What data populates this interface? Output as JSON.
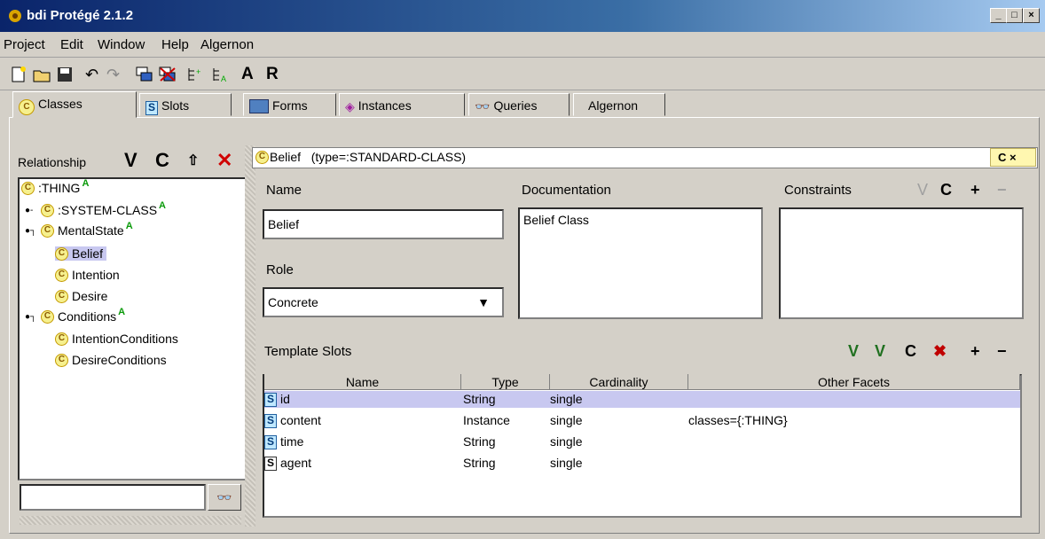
{
  "window": {
    "title": "bdi  Protégé 2.1.2"
  },
  "menu": [
    "Project",
    "Edit",
    "Window",
    "Help",
    "Algernon"
  ],
  "toolbar": {
    "a_label": "A",
    "r_label": "R"
  },
  "tabs": [
    {
      "label": "Classes"
    },
    {
      "label": "Slots"
    },
    {
      "label": "Forms"
    },
    {
      "label": "Instances"
    },
    {
      "label": "Queries"
    },
    {
      "label": "Algernon"
    }
  ],
  "left": {
    "relationship_label": "Relationship",
    "buttons": {
      "v": "V",
      "c": "C"
    },
    "tree": [
      {
        "label": ":THING",
        "badge": "A"
      },
      {
        "label": ":SYSTEM-CLASS",
        "badge": "A"
      },
      {
        "label": "MentalState",
        "badge": "A"
      },
      {
        "label": "Belief"
      },
      {
        "label": "Intention"
      },
      {
        "label": "Desire"
      },
      {
        "label": "Conditions",
        "badge": "A"
      },
      {
        "label": "IntentionConditions"
      },
      {
        "label": "DesireConditions"
      }
    ],
    "search_value": ""
  },
  "class_header": {
    "name": "Belief",
    "type": "(type=:STANDARD-CLASS)",
    "cx": "C ×"
  },
  "form": {
    "name_label": "Name",
    "name_value": "Belief",
    "doc_label": "Documentation",
    "doc_value": "Belief Class",
    "constraints_label": "Constraints",
    "constraints_buttons": {
      "v": "V",
      "c": "C",
      "add": "+",
      "remove": "−"
    },
    "role_label": "Role",
    "role_value": "Concrete",
    "template_label": "Template Slots",
    "template_buttons": {
      "v1": "V",
      "v2": "V",
      "c": "C",
      "add": "+",
      "remove": "−"
    }
  },
  "table": {
    "columns": [
      "Name",
      "Type",
      "Cardinality",
      "Other Facets"
    ],
    "rows": [
      {
        "name": "id",
        "type": "String",
        "card": "single",
        "facets": ""
      },
      {
        "name": "content",
        "type": "Instance",
        "card": "single",
        "facets": "classes={:THING}"
      },
      {
        "name": "time",
        "type": "String",
        "card": "single",
        "facets": ""
      },
      {
        "name": "agent",
        "type": "String",
        "card": "single",
        "facets": ""
      }
    ]
  },
  "colors": {
    "titlebar": "#0a246a",
    "selection": "#c8c8f0",
    "badge": "#0a9a0a"
  }
}
